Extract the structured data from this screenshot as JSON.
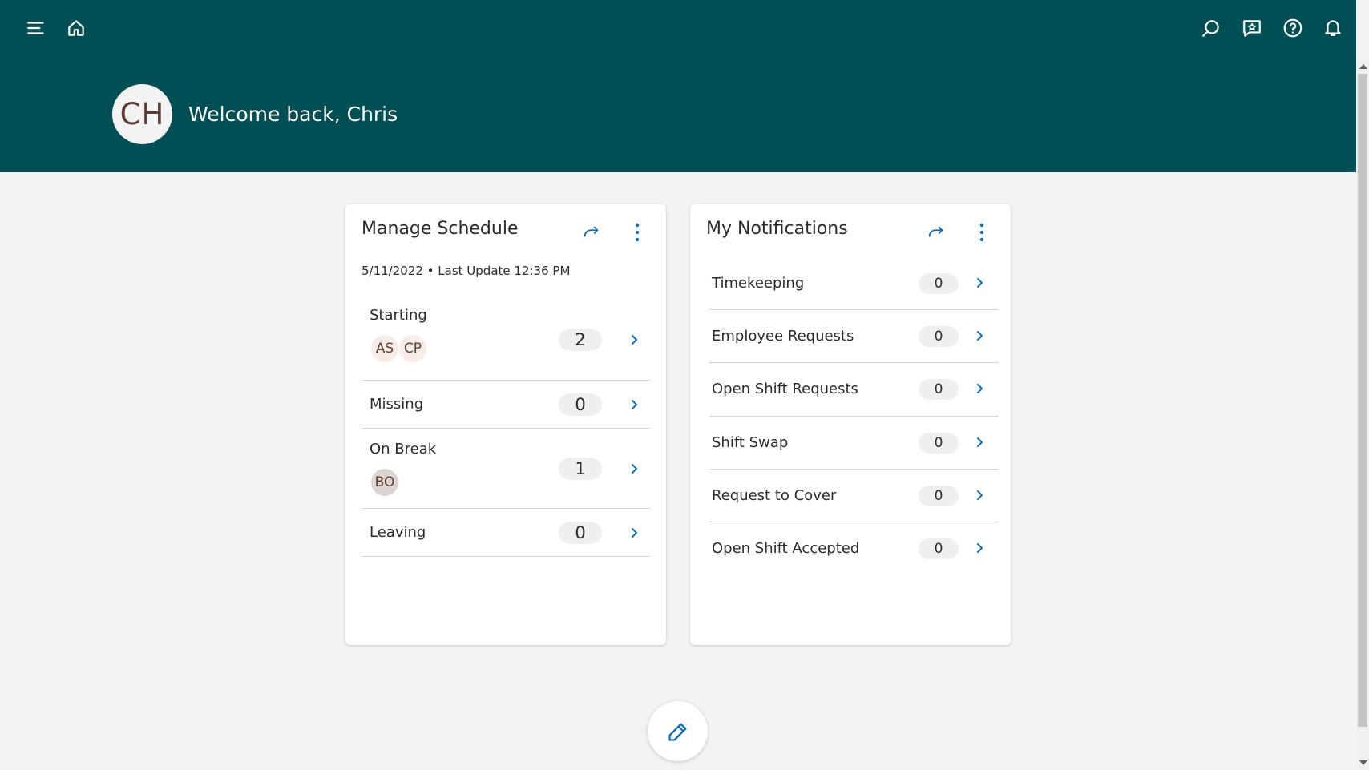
{
  "header": {
    "avatar_initials": "CH",
    "welcome_text": "Welcome back, Chris",
    "icons": [
      "menu-icon",
      "home-icon",
      "search-icon",
      "feedback-icon",
      "help-icon",
      "bell-icon"
    ],
    "background_color": "#004f54"
  },
  "manage_schedule": {
    "title": "Manage Schedule",
    "last_update": "5/11/2022 • Last Update 12:36 PM",
    "rows": [
      {
        "label": "Starting",
        "count": "2",
        "avatars": [
          "AS",
          "CP"
        ]
      },
      {
        "label": "Missing",
        "count": "0",
        "avatars": []
      },
      {
        "label": "On Break",
        "count": "1",
        "avatars": [
          "BO"
        ]
      },
      {
        "label": "Leaving",
        "count": "0",
        "avatars": []
      }
    ]
  },
  "my_notifications": {
    "title": "My Notifications",
    "rows": [
      {
        "label": "Timekeeping",
        "count": "0"
      },
      {
        "label": "Employee Requests",
        "count": "0"
      },
      {
        "label": "Open Shift Requests",
        "count": "0"
      },
      {
        "label": "Shift Swap",
        "count": "0"
      },
      {
        "label": "Request to Cover",
        "count": "0"
      },
      {
        "label": "Open Shift Accepted",
        "count": "0"
      }
    ]
  },
  "colors": {
    "accent": "#0f6fb4",
    "page_background": "#f3f3f3"
  }
}
